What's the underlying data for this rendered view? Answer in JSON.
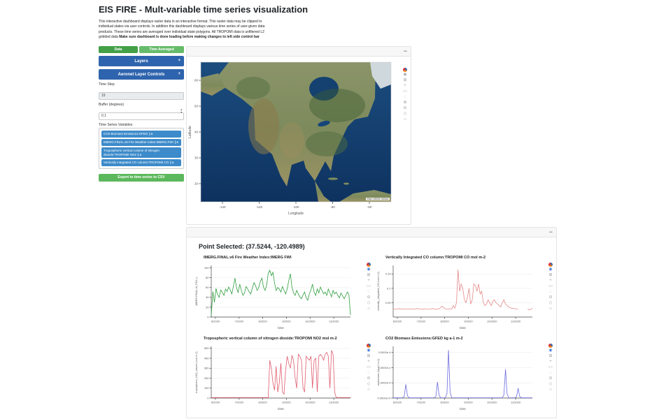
{
  "header": {
    "title": "EIS FIRE - Mult-variable time series visualization",
    "description": "This interactive dashboard displays raster data in an interactive format. This raster data may be clipped to individual states via user controls. In addition this dashboard displays various time series of user-given data products. These time series are averaged over individual state polygons. All TROPOMI data is unfiltered L2 gridded data ",
    "description_bold": "Make sure dashboard is done loading before making changes to left side control bar"
  },
  "sidebar": {
    "data_button": "Data",
    "time_averaged_button": "Time Averaged",
    "layers_header": "Layers",
    "layers_expand": "+",
    "aeronet_header": "Aeronet Layer Controls",
    "aeronet_expand": "+",
    "time_step_label": "Time Step",
    "time_step_value": "15",
    "buffer_label": "Buffer (degrees)",
    "buffer_value": "0.1",
    "variables_label": "Time Series Variables",
    "variables": [
      {
        "label": "CO2 Biomass Emissions:GFED",
        "close": "| x"
      },
      {
        "label": "IMERG.FINAL.v6 Fire Weather Index:IMERG.FWI",
        "close": "| x"
      },
      {
        "label": "Tropospheric vertical column of nitrogen dioxide:TROPOMI NO2",
        "close": "| x"
      },
      {
        "label": "Vertically integrated CO column:TROPOMI CO",
        "close": "| x"
      }
    ],
    "export_button": "Export to time series to CSV"
  },
  "map_card": {
    "collapse_label": "−"
  },
  "point_card": {
    "collapse_label": "−",
    "title": "Point Selected: (37.5244, -120.4989)"
  },
  "map": {
    "xlabel": "Longitude",
    "ylabel": "Latitude",
    "xticks": [
      "-140",
      "-120",
      "-100",
      "-80",
      "-60"
    ],
    "yticks": [
      "60",
      "50",
      "40",
      "30",
      "20"
    ],
    "attribution": "Esri, USGS, NOAA"
  },
  "modebar": {
    "map": [
      {
        "name": "plotly-logo",
        "glyph": ""
      },
      {
        "name": "camera",
        "glyph": "◉"
      },
      {
        "name": "zoom",
        "glyph": "⊞"
      },
      {
        "name": "pan",
        "glyph": "+"
      },
      {
        "name": "box-select",
        "glyph": "▭"
      },
      {
        "name": "lasso-select",
        "glyph": "◌"
      },
      {
        "name": "zoom-in",
        "glyph": "⊕"
      },
      {
        "name": "zoom-out",
        "glyph": "⊖"
      },
      {
        "name": "autoscale",
        "glyph": "◇"
      },
      {
        "name": "reset-axes",
        "glyph": "⌂"
      }
    ],
    "chart": [
      {
        "name": "plotly-logo",
        "glyph": ""
      },
      {
        "name": "camera",
        "glyph": "◉",
        "active": true
      },
      {
        "name": "zoom",
        "glyph": "⊞"
      },
      {
        "name": "pan",
        "glyph": "+"
      },
      {
        "name": "box-select",
        "glyph": "▭"
      },
      {
        "name": "lasso-select",
        "glyph": "◌"
      },
      {
        "name": "zoom-out",
        "glyph": "⊖"
      },
      {
        "name": "autoscale",
        "glyph": "◇"
      },
      {
        "name": "reset-axes",
        "glyph": "⌂"
      }
    ]
  },
  "chart_data": [
    {
      "type": "line",
      "title": "IMERG.FINAL.v6 Fire Weather Index:IMERG FWI",
      "color": "#2f9e3f",
      "xlabel": "time",
      "ylabel": "IMERG.FINAL.v6_FWI (-)",
      "ymin": 0,
      "ymax": 105,
      "yticks": [
        {
          "v": 0,
          "label": "0"
        },
        {
          "v": 20,
          "label": "20"
        },
        {
          "v": 40,
          "label": "40"
        },
        {
          "v": 60,
          "label": "60"
        },
        {
          "v": 80,
          "label": "80"
        },
        {
          "v": 100,
          "label": "100"
        }
      ],
      "xticks": [
        "6/2020",
        "7/2020",
        "8/2020",
        "9/2020",
        "10/2020",
        "11/2020"
      ],
      "values": [
        4,
        52,
        30,
        58,
        46,
        40,
        55,
        50,
        44,
        57,
        52,
        61,
        55,
        47,
        63,
        79,
        59,
        50,
        67,
        54,
        44,
        49,
        62,
        57,
        51,
        47,
        59,
        70,
        64,
        54,
        60,
        72,
        79,
        61,
        54,
        64,
        89,
        95,
        84,
        91,
        69,
        54,
        60,
        57,
        51,
        62,
        54,
        47,
        57,
        74,
        88,
        61,
        49,
        44,
        54,
        47,
        41,
        37,
        45,
        51,
        39,
        34,
        47,
        55,
        67,
        51,
        44,
        57,
        49,
        61,
        54,
        47,
        51,
        44,
        57,
        49,
        41,
        54,
        47,
        51,
        44,
        39,
        49,
        43,
        37,
        44,
        51,
        46,
        4
      ]
    },
    {
      "type": "line",
      "title": "Vertically Integrated CO column:TROPOMI CO mol m-2",
      "color": "#e58a8a",
      "xlabel": "time",
      "ylabel": "vertically_integrated_CO (mol m-2)",
      "ymin": 0,
      "ymax": 0.18,
      "yticks": [
        {
          "v": 0.05,
          "label": "0.05"
        },
        {
          "v": 0.1,
          "label": "0.1"
        },
        {
          "v": 0.15,
          "label": "0.15"
        }
      ],
      "xticks": [
        "6/2020",
        "7/2020",
        "8/2020",
        "9/2020",
        "10/2020",
        "11/2020"
      ],
      "values": [
        0.028,
        0.029,
        0.027,
        0.028,
        0.03,
        0.028,
        0.027,
        0.029,
        0.028,
        0.027,
        0.028,
        0.029,
        0.028,
        0.027,
        0.028,
        0.03,
        0.029,
        0.028,
        0.027,
        0.028,
        0.029,
        0.028,
        0.027,
        0.028,
        0.029,
        0.03,
        0.028,
        0.027,
        0.028,
        0.029,
        0.033,
        0.038,
        0.032,
        0.028,
        0.027,
        0.028,
        0.029,
        0.028,
        0.04,
        0.031,
        0.05,
        0.165,
        0.09,
        0.115,
        0.1,
        0.06,
        0.05,
        0.07,
        0.1,
        0.045,
        0.06,
        0.115,
        0.11,
        0.09,
        0.115,
        0.08,
        0.09,
        0.05,
        0.04,
        0.045,
        0.06,
        0.05,
        0.04,
        0.055,
        0.06,
        0.05,
        0.045,
        0.04,
        0.035,
        0.05,
        0.06,
        0.045,
        0.04,
        0.035,
        0.033,
        0.03,
        0.03,
        0.029,
        0.028,
        0.028,
        null,
        0.027,
        null,
        0.026,
        null,
        0.028,
        0.025,
        0.027,
        0.031
      ]
    },
    {
      "type": "line",
      "title": "Tropospheric vertical column of nitrogen dioxide:TROPOMI NO2 mol m-2",
      "color": "#e05c6e",
      "xlabel": "time",
      "ylabel": "tropospheric_NO2_column (mol m-2)",
      "ymin": 0,
      "ymax": 520,
      "yticks": [
        {
          "v": 0,
          "label": "0"
        },
        {
          "v": 100,
          "label": "100"
        },
        {
          "v": 200,
          "label": "200"
        },
        {
          "v": 300,
          "label": "300"
        },
        {
          "v": 400,
          "label": "400"
        },
        {
          "v": 500,
          "label": "500"
        }
      ],
      "xticks": [
        "6/2020",
        "7/2020",
        "8/2020",
        "9/2020",
        "10/2020",
        "11/2020"
      ],
      "values": [
        5,
        5,
        5,
        5,
        5,
        5,
        5,
        5,
        5,
        5,
        5,
        5,
        5,
        5,
        5,
        5,
        5,
        5,
        5,
        5,
        5,
        5,
        5,
        5,
        5,
        5,
        5,
        5,
        5,
        5,
        5,
        5,
        5,
        5,
        5,
        5,
        5,
        380,
        300,
        150,
        80,
        320,
        60,
        150,
        350,
        60,
        40,
        280,
        420,
        350,
        300,
        430,
        380,
        200,
        100,
        440,
        420,
        380,
        100,
        60,
        420,
        400,
        380,
        420,
        100,
        380,
        400,
        60,
        420,
        440,
        420,
        380,
        440,
        460,
        420,
        100,
        480,
        440,
        60,
        5,
        5,
        5,
        5,
        5,
        5,
        5,
        5,
        5,
        5
      ]
    },
    {
      "type": "line",
      "title": "CO2 Biomass Emissions:GFED kg a-1 m-2",
      "color": "#6b6bdf",
      "xlabel": "time",
      "ylabel": "co.biomass (kg a-1 m-2)",
      "ymin": 0,
      "ymax": 0.00034,
      "yticks": [
        {
          "v": 0,
          "label": "0.0000e+0"
        },
        {
          "v": 0.0001,
          "label": "1.0000e-4"
        },
        {
          "v": 0.0002,
          "label": "2.0000e-4"
        },
        {
          "v": 0.0003,
          "label": "3.0000e-4"
        }
      ],
      "xticks": [
        "6/2020",
        "7/2020",
        "8/2020",
        "9/2020",
        "10/2020",
        "11/2020"
      ],
      "values": [
        2e-06,
        2e-06,
        2e-06,
        2e-06,
        2e-06,
        2e-06,
        2e-06,
        1e-05,
        9e-05,
        1.5e-05,
        2e-06,
        2e-06,
        2e-06,
        2e-06,
        2e-06,
        2e-06,
        2e-06,
        2e-06,
        2e-06,
        2e-06,
        2e-06,
        2e-06,
        2e-06,
        2e-06,
        2e-06,
        2e-06,
        2e-06,
        1e-05,
        0.000105,
        2e-05,
        2e-06,
        2e-06,
        2e-06,
        2e-06,
        3e-05,
        0.000315,
        4e-05,
        2e-06,
        2e-06,
        2e-06,
        2e-06,
        2e-06,
        2e-06,
        2e-06,
        2e-06,
        2e-06,
        2e-06,
        2e-06,
        2e-06,
        2e-06,
        2e-06,
        2e-06,
        2e-06,
        2e-06,
        2e-06,
        2e-06,
        2e-06,
        2e-06,
        2e-06,
        2e-06,
        2e-06,
        2e-06,
        2e-06,
        2e-06,
        2e-06,
        2e-06,
        2e-06,
        2e-06,
        2e-06,
        2e-06,
        2e-05,
        0.00019,
        3e-05,
        2e-06,
        2e-06,
        2e-06,
        2e-06,
        2e-06,
        1e-05,
        6.5e-05,
        1e-05,
        2e-06,
        2e-06,
        2e-06,
        2e-06,
        2e-06,
        2e-06,
        2e-06,
        2e-06
      ]
    }
  ]
}
